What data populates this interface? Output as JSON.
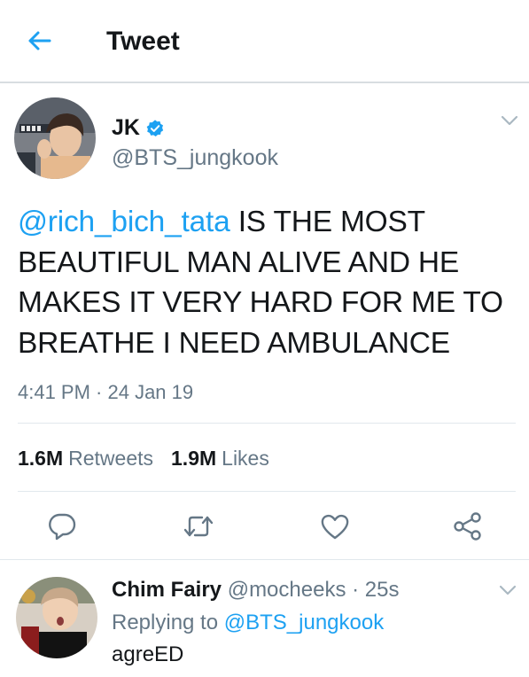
{
  "header": {
    "title": "Tweet",
    "back_icon": "arrow-left-icon",
    "accent": "#1da1f2"
  },
  "tweet": {
    "author_name": "JK",
    "author_handle": "@BTS_jungkook",
    "verified_icon": "verified-badge-icon",
    "mention": "@rich_bich_tata",
    "body": " IS THE MOST BEAUTIFUL MAN ALIVE AND HE MAKES IT VERY HARD FOR ME TO BREATHE I NEED AMBULANCE",
    "timestamp": "4:41 PM · 24 Jan 19",
    "retweets_count": "1.6M",
    "retweets_label": "Retweets",
    "likes_count": "1.9M",
    "likes_label": "Likes",
    "actions": [
      "reply-icon",
      "retweet-icon",
      "like-icon",
      "share-icon"
    ]
  },
  "reply": {
    "author_name": "Chim Fairy",
    "author_handle": "@mocheeks",
    "time": "· 25s",
    "replying_prefix": "Replying to",
    "replying_to": "@BTS_jungkook",
    "text": "agreED"
  },
  "colors": {
    "text_primary": "#14171a",
    "text_secondary": "#657786",
    "link": "#1da1f2",
    "divider": "#e1e8ed"
  }
}
